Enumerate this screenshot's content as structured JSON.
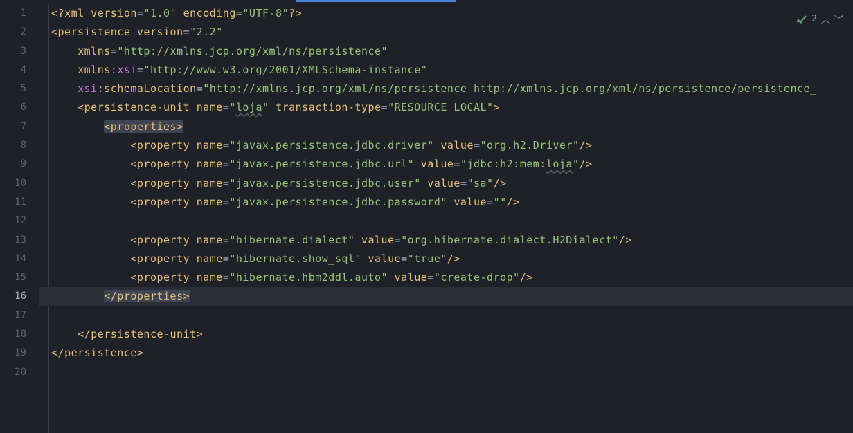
{
  "lines": [
    {
      "num": "1",
      "tokens": [
        {
          "t": "<?",
          "c": "bracket"
        },
        {
          "t": "xml ",
          "c": "tag"
        },
        {
          "t": "version",
          "c": "attr"
        },
        {
          "t": "=",
          "c": "eq"
        },
        {
          "t": "\"1.0\"",
          "c": "str"
        },
        {
          "t": " ",
          "c": "punct"
        },
        {
          "t": "encoding",
          "c": "attr"
        },
        {
          "t": "=",
          "c": "eq"
        },
        {
          "t": "\"UTF-8\"",
          "c": "str"
        },
        {
          "t": "?>",
          "c": "bracket"
        }
      ]
    },
    {
      "num": "2",
      "tokens": [
        {
          "t": "<",
          "c": "bracket"
        },
        {
          "t": "persistence ",
          "c": "tag"
        },
        {
          "t": "version",
          "c": "attr"
        },
        {
          "t": "=",
          "c": "eq"
        },
        {
          "t": "\"2.2\"",
          "c": "str"
        }
      ]
    },
    {
      "num": "3",
      "tokens": [
        {
          "t": "    ",
          "c": "punct"
        },
        {
          "t": "xmlns",
          "c": "attr"
        },
        {
          "t": "=",
          "c": "eq"
        },
        {
          "t": "\"http://xmlns.jcp.org/xml/ns/persistence\"",
          "c": "str"
        }
      ]
    },
    {
      "num": "4",
      "tokens": [
        {
          "t": "    ",
          "c": "punct"
        },
        {
          "t": "xmlns",
          "c": "attr"
        },
        {
          "t": ":",
          "c": "ns-colon"
        },
        {
          "t": "xsi",
          "c": "attr-ns"
        },
        {
          "t": "=",
          "c": "eq"
        },
        {
          "t": "\"http://www.w3.org/2001/XMLSchema-instance\"",
          "c": "str"
        }
      ]
    },
    {
      "num": "5",
      "tokens": [
        {
          "t": "    ",
          "c": "punct"
        },
        {
          "t": "xsi",
          "c": "attr-ns"
        },
        {
          "t": ":",
          "c": "ns-colon"
        },
        {
          "t": "schemaLocation",
          "c": "attr"
        },
        {
          "t": "=",
          "c": "eq"
        },
        {
          "t": "\"http://xmlns.jcp.org/xml/ns/persistence http://xmlns.jcp.org/xml/ns/persistence/persistence_",
          "c": "str"
        }
      ]
    },
    {
      "num": "6",
      "tokens": [
        {
          "t": "    ",
          "c": "punct"
        },
        {
          "t": "<",
          "c": "bracket"
        },
        {
          "t": "persistence-unit ",
          "c": "tag"
        },
        {
          "t": "name",
          "c": "attr"
        },
        {
          "t": "=",
          "c": "eq"
        },
        {
          "t": "\"",
          "c": "str"
        },
        {
          "t": "loja",
          "c": "str",
          "u": true
        },
        {
          "t": "\"",
          "c": "str"
        },
        {
          "t": " ",
          "c": "punct"
        },
        {
          "t": "transaction-type",
          "c": "attr"
        },
        {
          "t": "=",
          "c": "eq"
        },
        {
          "t": "\"RESOURCE_LOCAL\"",
          "c": "str"
        },
        {
          "t": ">",
          "c": "bracket"
        }
      ]
    },
    {
      "num": "7",
      "tokens": [
        {
          "t": "        ",
          "c": "punct"
        },
        {
          "t": "<properties>",
          "c": "tag",
          "m": true
        }
      ]
    },
    {
      "num": "8",
      "tokens": [
        {
          "t": "            ",
          "c": "punct"
        },
        {
          "t": "<",
          "c": "bracket"
        },
        {
          "t": "property ",
          "c": "tag"
        },
        {
          "t": "name",
          "c": "attr"
        },
        {
          "t": "=",
          "c": "eq"
        },
        {
          "t": "\"javax.persistence.jdbc.driver\"",
          "c": "str"
        },
        {
          "t": " ",
          "c": "punct"
        },
        {
          "t": "value",
          "c": "attr"
        },
        {
          "t": "=",
          "c": "eq"
        },
        {
          "t": "\"org.h2.Driver\"",
          "c": "str"
        },
        {
          "t": "/>",
          "c": "bracket"
        }
      ]
    },
    {
      "num": "9",
      "tokens": [
        {
          "t": "            ",
          "c": "punct"
        },
        {
          "t": "<",
          "c": "bracket"
        },
        {
          "t": "property ",
          "c": "tag"
        },
        {
          "t": "name",
          "c": "attr"
        },
        {
          "t": "=",
          "c": "eq"
        },
        {
          "t": "\"javax.persistence.jdbc.url\"",
          "c": "str"
        },
        {
          "t": " ",
          "c": "punct"
        },
        {
          "t": "value",
          "c": "attr"
        },
        {
          "t": "=",
          "c": "eq"
        },
        {
          "t": "\"jdbc:h2:mem:",
          "c": "str"
        },
        {
          "t": "loja",
          "c": "str",
          "u": true
        },
        {
          "t": "\"",
          "c": "str"
        },
        {
          "t": "/>",
          "c": "bracket"
        }
      ]
    },
    {
      "num": "10",
      "tokens": [
        {
          "t": "            ",
          "c": "punct"
        },
        {
          "t": "<",
          "c": "bracket"
        },
        {
          "t": "property ",
          "c": "tag"
        },
        {
          "t": "name",
          "c": "attr"
        },
        {
          "t": "=",
          "c": "eq"
        },
        {
          "t": "\"javax.persistence.jdbc.user\"",
          "c": "str"
        },
        {
          "t": " ",
          "c": "punct"
        },
        {
          "t": "value",
          "c": "attr"
        },
        {
          "t": "=",
          "c": "eq"
        },
        {
          "t": "\"sa\"",
          "c": "str"
        },
        {
          "t": "/>",
          "c": "bracket"
        }
      ]
    },
    {
      "num": "11",
      "tokens": [
        {
          "t": "            ",
          "c": "punct"
        },
        {
          "t": "<",
          "c": "bracket"
        },
        {
          "t": "property ",
          "c": "tag"
        },
        {
          "t": "name",
          "c": "attr"
        },
        {
          "t": "=",
          "c": "eq"
        },
        {
          "t": "\"javax.persistence.jdbc.password\"",
          "c": "str"
        },
        {
          "t": " ",
          "c": "punct"
        },
        {
          "t": "value",
          "c": "attr"
        },
        {
          "t": "=",
          "c": "eq"
        },
        {
          "t": "\"\"",
          "c": "str"
        },
        {
          "t": "/>",
          "c": "bracket"
        }
      ]
    },
    {
      "num": "12",
      "tokens": []
    },
    {
      "num": "13",
      "tokens": [
        {
          "t": "            ",
          "c": "punct"
        },
        {
          "t": "<",
          "c": "bracket"
        },
        {
          "t": "property ",
          "c": "tag"
        },
        {
          "t": "name",
          "c": "attr"
        },
        {
          "t": "=",
          "c": "eq"
        },
        {
          "t": "\"hibernate.dialect\"",
          "c": "str"
        },
        {
          "t": " ",
          "c": "punct"
        },
        {
          "t": "value",
          "c": "attr"
        },
        {
          "t": "=",
          "c": "eq"
        },
        {
          "t": "\"org.hibernate.dialect.H2Dialect\"",
          "c": "str"
        },
        {
          "t": "/>",
          "c": "bracket"
        }
      ]
    },
    {
      "num": "14",
      "tokens": [
        {
          "t": "            ",
          "c": "punct"
        },
        {
          "t": "<",
          "c": "bracket"
        },
        {
          "t": "property ",
          "c": "tag"
        },
        {
          "t": "name",
          "c": "attr"
        },
        {
          "t": "=",
          "c": "eq"
        },
        {
          "t": "\"hibernate.show_sql\"",
          "c": "str"
        },
        {
          "t": " ",
          "c": "punct"
        },
        {
          "t": "value",
          "c": "attr"
        },
        {
          "t": "=",
          "c": "eq"
        },
        {
          "t": "\"true\"",
          "c": "str"
        },
        {
          "t": "/>",
          "c": "bracket"
        }
      ]
    },
    {
      "num": "15",
      "tokens": [
        {
          "t": "            ",
          "c": "punct"
        },
        {
          "t": "<",
          "c": "bracket"
        },
        {
          "t": "property ",
          "c": "tag"
        },
        {
          "t": "name",
          "c": "attr"
        },
        {
          "t": "=",
          "c": "eq"
        },
        {
          "t": "\"hibernate.hbm2ddl.auto\"",
          "c": "str"
        },
        {
          "t": " ",
          "c": "punct"
        },
        {
          "t": "value",
          "c": "attr"
        },
        {
          "t": "=",
          "c": "eq"
        },
        {
          "t": "\"create-drop\"",
          "c": "str"
        },
        {
          "t": "/>",
          "c": "bracket"
        }
      ]
    },
    {
      "num": "16",
      "active": true,
      "bulb": true,
      "tokens": [
        {
          "t": "        ",
          "c": "punct"
        },
        {
          "t": "</properties>",
          "c": "tag",
          "m": true
        }
      ]
    },
    {
      "num": "17",
      "tokens": []
    },
    {
      "num": "18",
      "tokens": [
        {
          "t": "    ",
          "c": "punct"
        },
        {
          "t": "</",
          "c": "bracket"
        },
        {
          "t": "persistence-unit",
          "c": "tag"
        },
        {
          "t": ">",
          "c": "bracket"
        }
      ]
    },
    {
      "num": "19",
      "tokens": [
        {
          "t": "</",
          "c": "bracket"
        },
        {
          "t": "persistence",
          "c": "tag"
        },
        {
          "t": ">",
          "c": "bracket"
        }
      ]
    },
    {
      "num": "20",
      "tokens": []
    }
  ],
  "inspections": {
    "count": "2",
    "icon": "check-wavy"
  }
}
